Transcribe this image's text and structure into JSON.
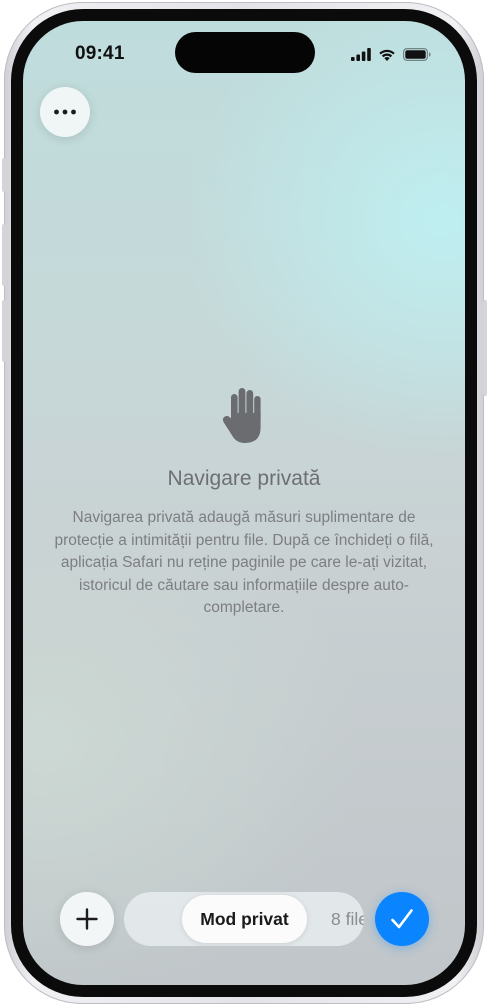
{
  "status_bar": {
    "time": "09:41",
    "icons": [
      "cellular-signal-icon",
      "wifi-icon",
      "battery-icon"
    ]
  },
  "top_bar": {
    "more_icon": "ellipsis-icon"
  },
  "private_browsing": {
    "icon": "raised-hand-icon",
    "title": "Navigare privată",
    "description": "Navigarea privată adaugă măsuri suplimentare de protecție a intimității pentru file. După ce închideți o filă, aplicația Safari nu reține paginile pe care le-ați vizitat, istoricul de căutare sau informațiile despre auto-completare."
  },
  "toolbar": {
    "new_tab_icon": "plus-icon",
    "segments": {
      "private_label": "Mod privat",
      "tabs_label": "8 file"
    },
    "selected_segment": "Mod privat",
    "done_icon": "checkmark-icon"
  },
  "colors": {
    "accent": "#0a84ff",
    "text_secondary": "#7c7e82",
    "hand_icon": "#6a6c70"
  }
}
